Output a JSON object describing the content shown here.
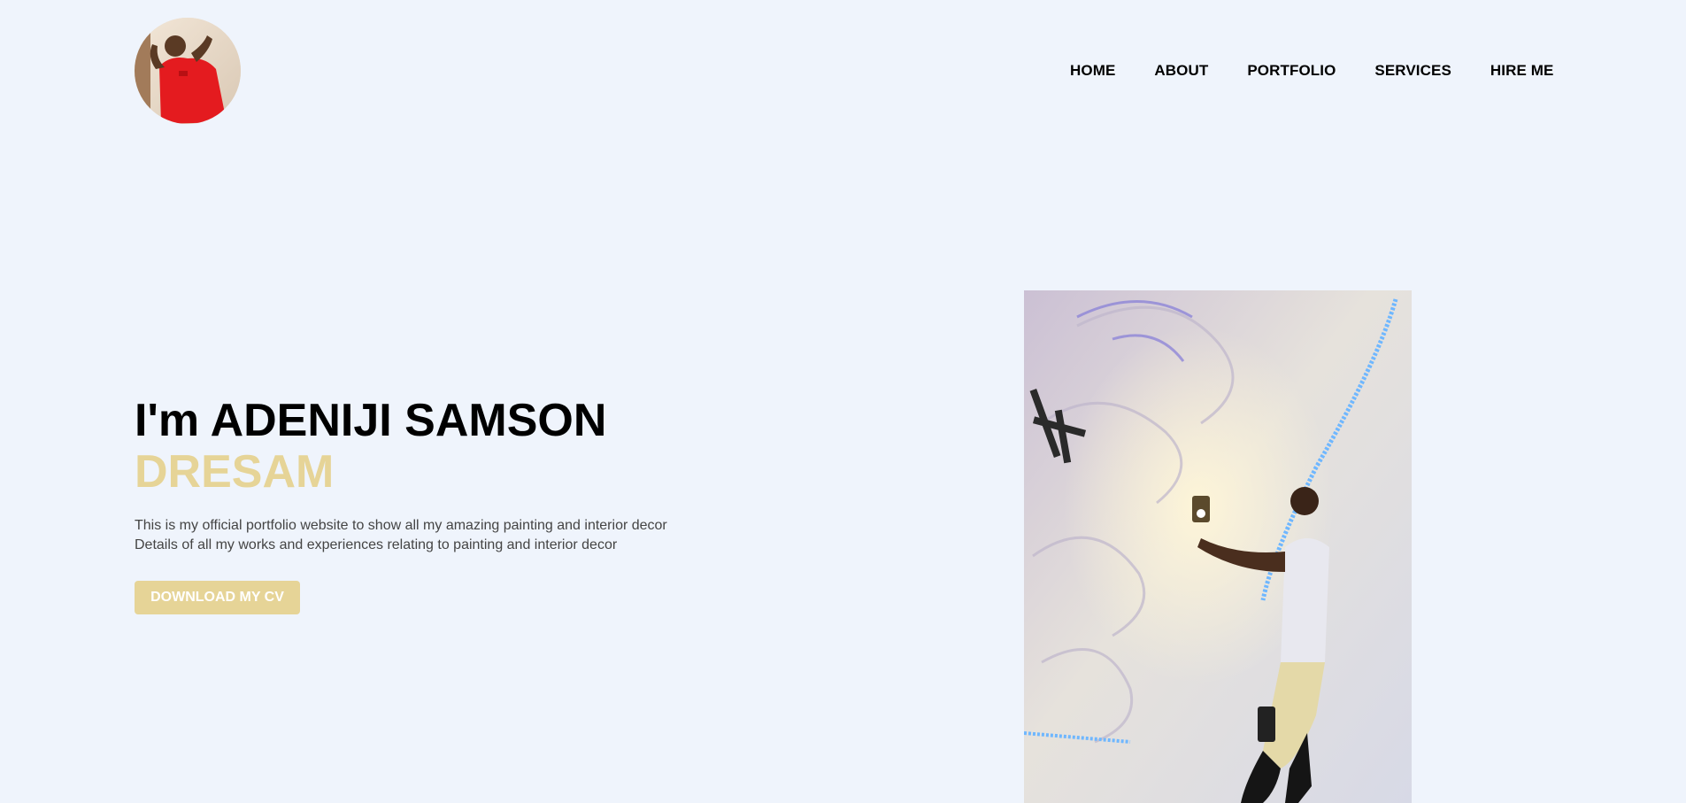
{
  "header": {
    "logo_icon": "profile-avatar-photo",
    "nav": [
      {
        "label": "HOME"
      },
      {
        "label": "ABOUT"
      },
      {
        "label": "PORTFOLIO"
      },
      {
        "label": "SERVICES"
      },
      {
        "label": "HIRE ME"
      }
    ]
  },
  "hero": {
    "title": "I'm ADENIJI SAMSON",
    "accent": "DRESAM",
    "description_lines": [
      "This is my official portfolio website to show all my amazing painting and interior decor",
      "Details of all my works and experiences relating to painting and interior decor"
    ],
    "cta_label": "DOWNLOAD MY CV",
    "image_icon": "interior-decor-photo"
  },
  "colors": {
    "background": "#eff4fc",
    "accent": "#e6d497",
    "text": "#000000",
    "muted_text": "#444444"
  }
}
